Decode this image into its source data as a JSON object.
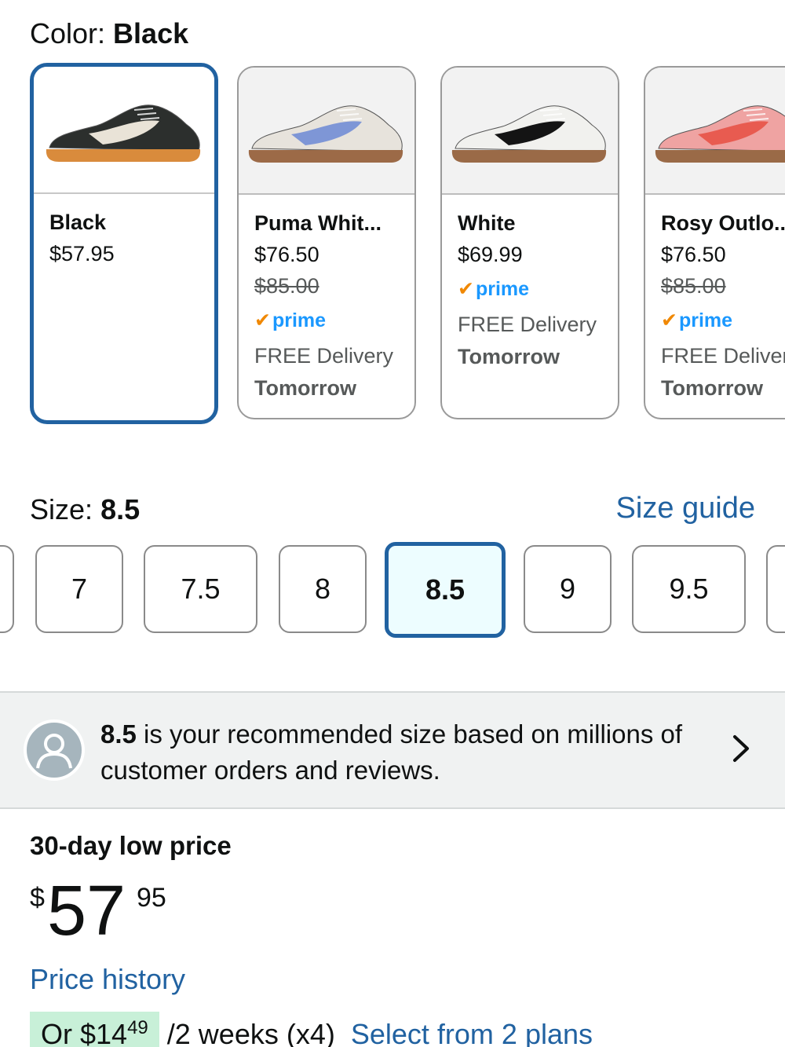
{
  "color": {
    "label": "Color:",
    "value": "Black"
  },
  "swatches": [
    {
      "name": "Black",
      "price": "$57.95",
      "original_price": "",
      "prime": false,
      "delivery": "",
      "delivery_day": "",
      "selected": true,
      "shoe_color": "#2c2f2d",
      "stripe_color": "#e9e3d7",
      "sole_color": "#d98b3c"
    },
    {
      "name": "Puma Whit...",
      "price": "$76.50",
      "original_price": "$85.00",
      "prime": true,
      "delivery": "FREE Delivery",
      "delivery_day": "Tomorrow",
      "selected": false,
      "shoe_color": "#e7e3dc",
      "stripe_color": "#7e96d6",
      "sole_color": "#9c6a47"
    },
    {
      "name": "White",
      "price": "$69.99",
      "original_price": "",
      "prime": true,
      "delivery": "FREE Delivery",
      "delivery_day": "Tomorrow",
      "selected": false,
      "shoe_color": "#f1f1ee",
      "stripe_color": "#141414",
      "sole_color": "#9a6a47"
    },
    {
      "name": "Rosy Outlo...",
      "price": "$76.50",
      "original_price": "$85.00",
      "prime": true,
      "delivery": "FREE Delivery",
      "delivery_day": "Tomorrow",
      "selected": false,
      "shoe_color": "#efa3a2",
      "stripe_color": "#e85b50",
      "sole_color": "#9a6a47"
    }
  ],
  "prime_label": "prime",
  "size": {
    "label": "Size:",
    "value": "8.5",
    "guide_link": "Size guide"
  },
  "sizes": [
    "7",
    "7.5",
    "8",
    "8.5",
    "9",
    "9.5"
  ],
  "selected_size": "8.5",
  "recommendation": {
    "size": "8.5",
    "text": " is your recommended size based on millions of customer orders and reviews."
  },
  "pricing": {
    "label": "30-day low price",
    "currency": "$",
    "whole": "57",
    "fraction": "95",
    "history_link": "Price history",
    "installment_prefix": "Or $14",
    "installment_cents": "49",
    "installment_suffix": " /2 weeks (x4)",
    "plans_link": "Select from 2 plans"
  },
  "colors": {
    "accent": "#2162a1",
    "selected_bg": "#edfdff",
    "prime_blue": "#1a98ff",
    "prime_check": "#f08804",
    "banner_bg": "#f0f2f2"
  }
}
